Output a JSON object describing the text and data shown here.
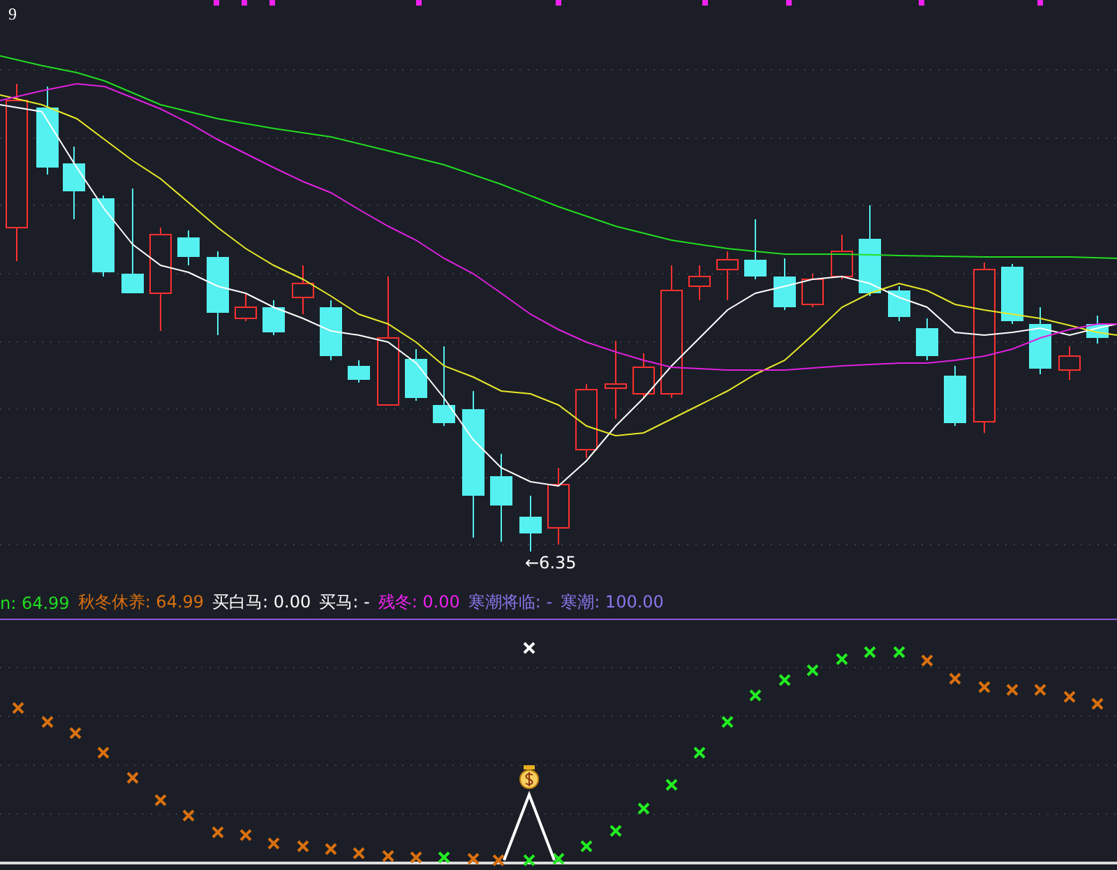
{
  "price_panel": {
    "top_label": "9",
    "low_label": "←6.35"
  },
  "indicator_legend": [
    {
      "text": "n: 64.99",
      "color": "#22dd22"
    },
    {
      "text": "秋冬休养: 64.99",
      "color": "#d9700f"
    },
    {
      "text": "买白马: 0.00",
      "color": "#ffffff"
    },
    {
      "text": "买马: -",
      "color": "#ffffff"
    },
    {
      "text": "残冬: 0.00",
      "color": "#ee22ee"
    },
    {
      "text": "寒潮将临: -",
      "color": "#8877ee"
    },
    {
      "text": "寒潮: 100.00",
      "color": "#8877ee"
    }
  ]
}
